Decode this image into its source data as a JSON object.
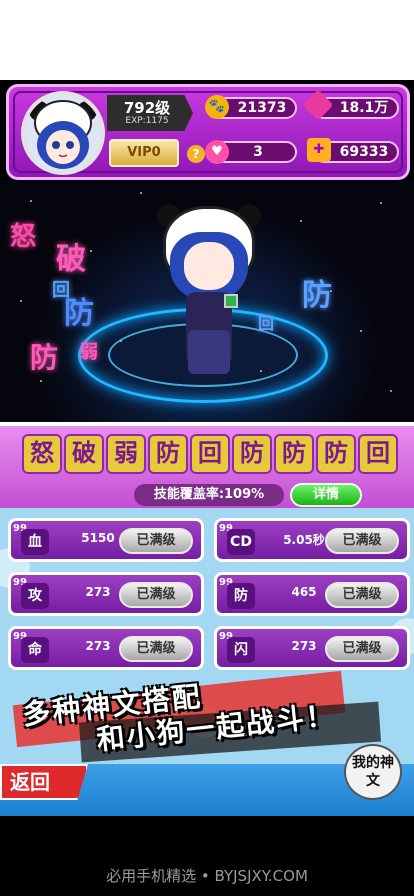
{
  "player": {
    "level": "792级",
    "exp": "EXP:1175",
    "vip": "VIP0"
  },
  "resources": {
    "paw_coins": "21373",
    "gems": "18.1万",
    "hearts": "3",
    "puzzle": "69333"
  },
  "scene_texts": [
    "怒",
    "破",
    "回",
    "防",
    "防",
    "弱",
    "防",
    "回"
  ],
  "skills": {
    "runes": [
      "怒",
      "破",
      "弱",
      "防",
      "回",
      "防",
      "防",
      "防",
      "回"
    ],
    "coverage_label": "技能覆盖率:109%",
    "detail_button": "详情"
  },
  "stats": [
    {
      "badge": "99",
      "name": "血",
      "value": "5150",
      "button": "已满级"
    },
    {
      "badge": "99",
      "name": "CD",
      "value": "5.05秒",
      "button": "已满级"
    },
    {
      "badge": "99",
      "name": "攻",
      "value": "273",
      "button": "已满级"
    },
    {
      "badge": "99",
      "name": "防",
      "value": "465",
      "button": "已满级"
    },
    {
      "badge": "99",
      "name": "命",
      "value": "273",
      "button": "已满级"
    },
    {
      "badge": "99",
      "name": "闪",
      "value": "273",
      "button": "已满级"
    }
  ],
  "banner": {
    "line1": "多种神文搭配",
    "line2": "和小狗一起战斗！"
  },
  "nav": {
    "back": "返回",
    "my_runes": "我的神文"
  },
  "footer": "必用手机精选 • BYJSJXY.COM",
  "colors": {
    "accent_purple": "#9d3fc2",
    "gold": "#e8c93b",
    "green": "#19b318",
    "red": "#de2a2c"
  }
}
